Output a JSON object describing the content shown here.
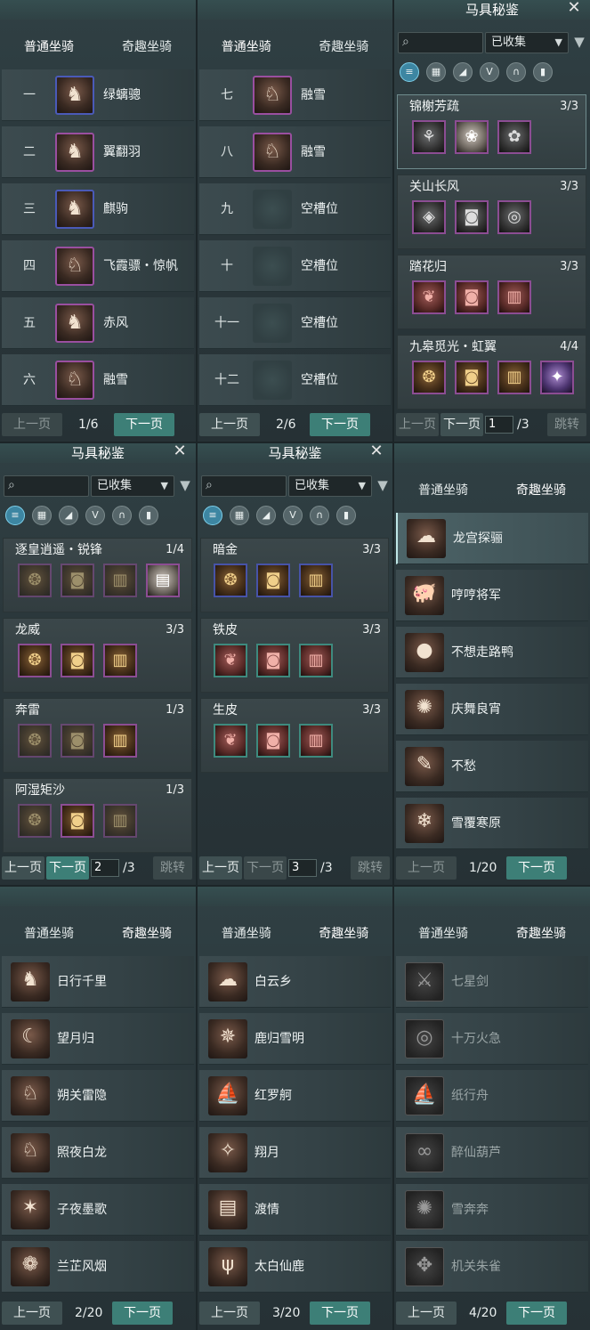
{
  "tabs": {
    "normal": "普通坐骑",
    "fun": "奇趣坐骑"
  },
  "pager": {
    "prev": "上一页",
    "next": "下一页",
    "jump": "跳转"
  },
  "harness": {
    "title": "马具秘鉴",
    "filter_value": "已收集",
    "search_placeholder": ""
  },
  "p1": {
    "rows": [
      {
        "num": "一",
        "name": "绿螭骢"
      },
      {
        "num": "二",
        "name": "翼翻羽"
      },
      {
        "num": "三",
        "name": "麒驹"
      },
      {
        "num": "四",
        "name": "飞霞骠・惊帆"
      },
      {
        "num": "五",
        "name": "赤风"
      },
      {
        "num": "六",
        "name": "融雪"
      }
    ],
    "page": "1/6"
  },
  "p2": {
    "rows": [
      {
        "num": "七",
        "name": "融雪"
      },
      {
        "num": "八",
        "name": "融雪"
      },
      {
        "num": "九",
        "name": "空槽位"
      },
      {
        "num": "十",
        "name": "空槽位"
      },
      {
        "num": "十一",
        "name": "空槽位"
      },
      {
        "num": "十二",
        "name": "空槽位"
      }
    ],
    "page": "2/6"
  },
  "p3": {
    "sets": [
      {
        "name": "锦榭芳疏",
        "count": "3/3"
      },
      {
        "name": "关山长风",
        "count": "3/3"
      },
      {
        "name": "踏花归",
        "count": "3/3"
      },
      {
        "name": "九皋觅光・虹翼",
        "count": "4/4"
      }
    ],
    "page_input": "1",
    "page_total": "/3"
  },
  "p4": {
    "sets": [
      {
        "name": "逐皇逍遥・锐锋",
        "count": "1/4"
      },
      {
        "name": "龙威",
        "count": "3/3"
      },
      {
        "name": "奔雷",
        "count": "1/3"
      },
      {
        "name": "阿湿矩沙",
        "count": "1/3"
      }
    ],
    "page_input": "2",
    "page_total": "/3"
  },
  "p5": {
    "sets": [
      {
        "name": "暗金",
        "count": "3/3"
      },
      {
        "name": "铁皮",
        "count": "3/3"
      },
      {
        "name": "生皮",
        "count": "3/3"
      }
    ],
    "page_input": "3",
    "page_total": "/3"
  },
  "p6": {
    "rows": [
      "龙宫探骊",
      "哼哼将军",
      "不想走路鸭",
      "庆舞良宵",
      "不愁",
      "雪覆寒原"
    ],
    "page": "1/20"
  },
  "p7": {
    "rows": [
      "日行千里",
      "望月归",
      "朔关雷隐",
      "照夜白龙",
      "子夜墨歌",
      "兰芷风烟"
    ],
    "page": "2/20"
  },
  "p8": {
    "rows": [
      "白云乡",
      "鹿归雪明",
      "红罗舸",
      "翔月",
      "渡情",
      "太白仙鹿"
    ],
    "page": "3/20"
  },
  "p9": {
    "rows": [
      "七星剑",
      "十万火急",
      "纸行舟",
      "醉仙葫芦",
      "雪奔奔",
      "机关朱雀"
    ],
    "page": "4/20"
  },
  "icons": {
    "horse": "horse-head-icon",
    "empty": "empty-slot-icon"
  }
}
